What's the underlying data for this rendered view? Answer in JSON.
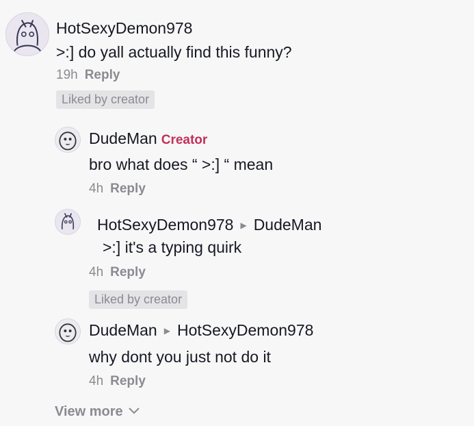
{
  "comments": [
    {
      "user": "HotSexyDemon978",
      "text": ">:] do yall actually find this funny?",
      "time": "19h",
      "reply_label": "Reply",
      "badge": "Liked by creator"
    },
    {
      "user": "DudeMan",
      "creator_label": "Creator",
      "text": "bro what does “ >:]  “ mean",
      "time": "4h",
      "reply_label": "Reply"
    },
    {
      "user": "HotSexyDemon978",
      "reply_to": "DudeMan",
      "text": ">:] it's a typing quirk",
      "time": "4h",
      "reply_label": "Reply",
      "badge": "Liked by creator"
    },
    {
      "user": "DudeMan",
      "reply_to": "HotSexyDemon978",
      "text": "why dont you just not do it",
      "time": "4h",
      "reply_label": "Reply"
    }
  ],
  "view_more_label": "View more",
  "colors": {
    "background": "#f7f7f7",
    "text": "#161823",
    "muted": "#8a8b91",
    "creator": "#c2305a",
    "badge_bg": "#e4e4e6"
  },
  "icons": {
    "reply_arrow": "caret-right-icon",
    "view_more": "chevron-down-icon",
    "avatar": "user-avatar"
  }
}
